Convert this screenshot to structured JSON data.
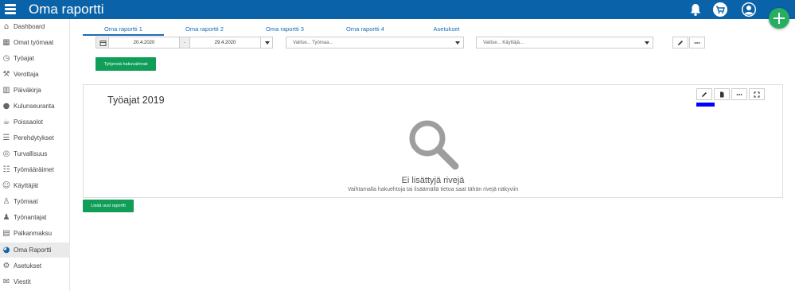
{
  "app": {
    "title": "Oma raportti"
  },
  "colors": {
    "topbar": "#0a63a8",
    "accent_green": "#0f9d58",
    "fab_green": "#27ae60",
    "tab_link": "#1a6db5",
    "series_blue": "#0000ff"
  },
  "header_icons": [
    "bell-icon",
    "cart-icon",
    "user-profile-icon"
  ],
  "sidebar": {
    "items": [
      {
        "label": "Dashboard",
        "icon": "dashboard-icon"
      },
      {
        "label": "Omat työmaat",
        "icon": "building-icon"
      },
      {
        "label": "Työajat",
        "icon": "clock-icon"
      },
      {
        "label": "Verottaja",
        "icon": "gavel-icon"
      },
      {
        "label": "Päiväkirja",
        "icon": "book-icon"
      },
      {
        "label": "Kulunseuranta",
        "icon": "map-pin-icon"
      },
      {
        "label": "Poissaolot",
        "icon": "coffee-icon"
      },
      {
        "label": "Perehdytykset",
        "icon": "checklist-icon"
      },
      {
        "label": "Turvallisuus",
        "icon": "safety-icon"
      },
      {
        "label": "Työmääräimet",
        "icon": "task-list-icon"
      },
      {
        "label": "Käyttäjät",
        "icon": "users-icon"
      },
      {
        "label": "Työmaat",
        "icon": "worker-icon"
      },
      {
        "label": "Työnantajat",
        "icon": "employer-icon"
      },
      {
        "label": "Palkanmaksu",
        "icon": "payment-icon"
      },
      {
        "label": "Oma Raportti",
        "icon": "pie-chart-icon",
        "active": true
      },
      {
        "label": "Asetukset",
        "icon": "gear-icon"
      },
      {
        "label": "Viestit",
        "icon": "mail-icon"
      }
    ]
  },
  "tabs": [
    {
      "label": "Oma raportti 1",
      "active": true
    },
    {
      "label": "Oma raportti 2"
    },
    {
      "label": "Oma raportti 3"
    },
    {
      "label": "Oma raportti 4"
    },
    {
      "label": "Asetukset"
    }
  ],
  "filters": {
    "date_start": "20.4.2020",
    "date_separator": "-",
    "date_end": "29.4.2020",
    "worksite_placeholder": "Valitse... Työmaa...",
    "user_placeholder": "Valitse... Käyttäjä...",
    "clear_button": "Tyhjennä hakuvalinnat"
  },
  "report": {
    "title": "Työajat 2019",
    "empty_title": "Ei lisättyjä rivejä",
    "empty_subtitle": "Vaihtamalla hakuehtoja tai lisäämällä tietoa saat tähän rivejä näkyviin"
  },
  "add_report_button": "Lisää uusi raportti"
}
